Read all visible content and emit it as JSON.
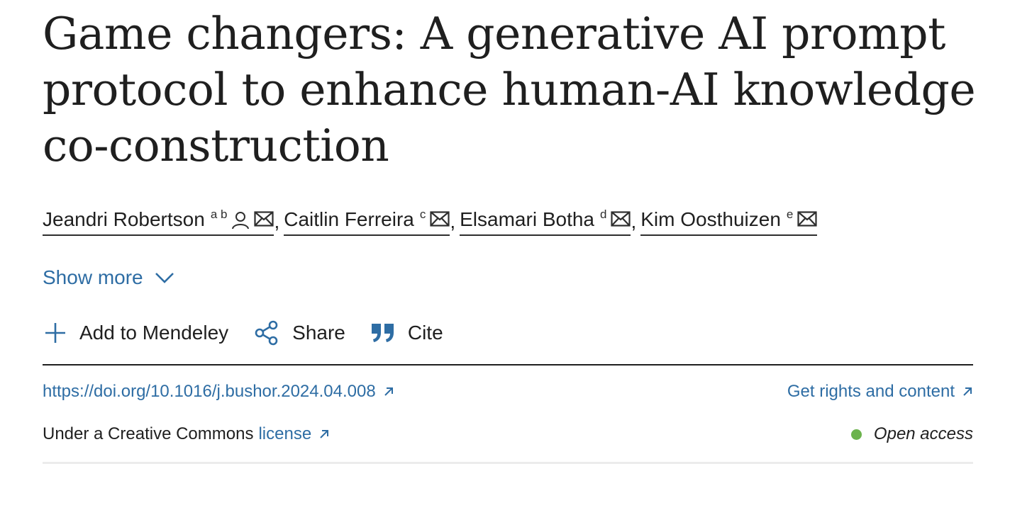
{
  "article": {
    "title": "Game changers: A generative AI prompt protocol to enhance human-AI knowledge co-construction"
  },
  "authors": [
    {
      "name": "Jeandri Robertson",
      "affiliations": "a b",
      "icons": [
        "person-icon",
        "envelope-icon"
      ]
    },
    {
      "name": "Caitlin Ferreira",
      "affiliations": "c",
      "icons": [
        "envelope-icon"
      ]
    },
    {
      "name": "Elsamari Botha",
      "affiliations": "d",
      "icons": [
        "envelope-icon"
      ]
    },
    {
      "name": "Kim Oosthuizen",
      "affiliations": "e",
      "icons": [
        "envelope-icon"
      ]
    }
  ],
  "author_separator": ",",
  "show_more": {
    "label": "Show more",
    "icon": "chevron-down-icon"
  },
  "actions": [
    {
      "label": "Add to Mendeley",
      "icon": "plus-icon"
    },
    {
      "label": "Share",
      "icon": "share-icon"
    },
    {
      "label": "Cite",
      "icon": "quote-icon"
    }
  ],
  "doi": {
    "label": "https://doi.org/10.1016/j.bushor.2024.04.008",
    "icon": "external-link-icon"
  },
  "rights": {
    "label": "Get rights and content",
    "icon": "external-link-icon"
  },
  "license": {
    "prefix": "Under a Creative Commons",
    "link_label": "license",
    "icon": "external-link-icon"
  },
  "open_access": {
    "label": "Open access",
    "dot_color": "#6cb34d"
  },
  "colors": {
    "link": "#2e6da4",
    "text": "#1f1f1f"
  }
}
